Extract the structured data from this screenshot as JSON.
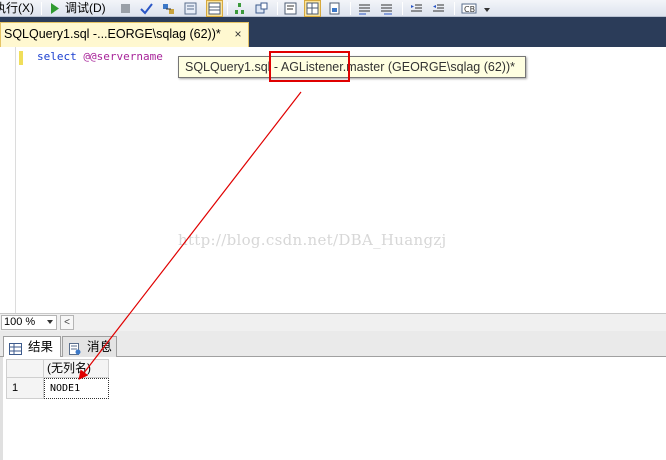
{
  "toolbar": {
    "execute_label": "执行(X)",
    "debug_label": "调试(D)"
  },
  "editor_tab": {
    "title": "SQLQuery1.sql -...EORGE\\sqlag (62))*",
    "close_glyph": "×"
  },
  "editor": {
    "code_keyword": "select",
    "code_variable": "@@servername",
    "tooltip": "SQLQuery1.sql - AGListener.master (GEORGE\\sqlag (62))*",
    "watermark": "http://blog.csdn.net/DBA_Huangzj"
  },
  "statusbar": {
    "zoom": "100 %",
    "scroll_left_glyph": "<"
  },
  "result_tabs": [
    {
      "label": "结果",
      "icon": "grid-icon",
      "active": true
    },
    {
      "label": "消息",
      "icon": "message-icon",
      "active": false
    }
  ],
  "results_grid": {
    "columns": [
      "(无列名)"
    ],
    "rows": [
      {
        "row_number": "1",
        "values": [
          "NODE1"
        ]
      }
    ]
  },
  "colors": {
    "annotation": "#e00000",
    "tab_strip": "#2b3c59",
    "active_tab": "#fff8d0"
  }
}
